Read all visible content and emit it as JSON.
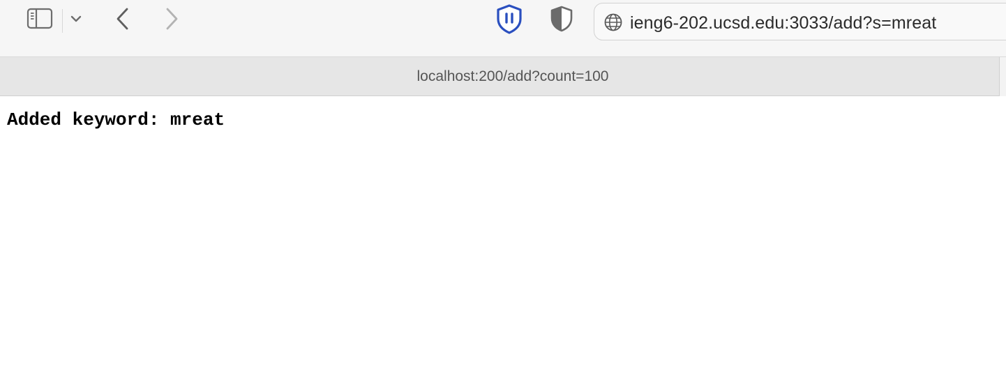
{
  "toolbar": {
    "sidebar_icon": "sidebar-icon",
    "chevron_icon": "chevron-down-icon",
    "back_icon": "back-arrow-icon",
    "forward_icon": "forward-arrow-icon",
    "extension_1_icon": "pause-shield-icon",
    "extension_2_icon": "half-shield-icon",
    "accent_color": "#2a4fbf"
  },
  "address_bar": {
    "icon": "globe-icon",
    "url": "ieng6-202.ucsd.edu:3033/add?s=mreat"
  },
  "tab": {
    "title": "localhost:200/add?count=100"
  },
  "page": {
    "text": "Added keyword: mreat"
  }
}
